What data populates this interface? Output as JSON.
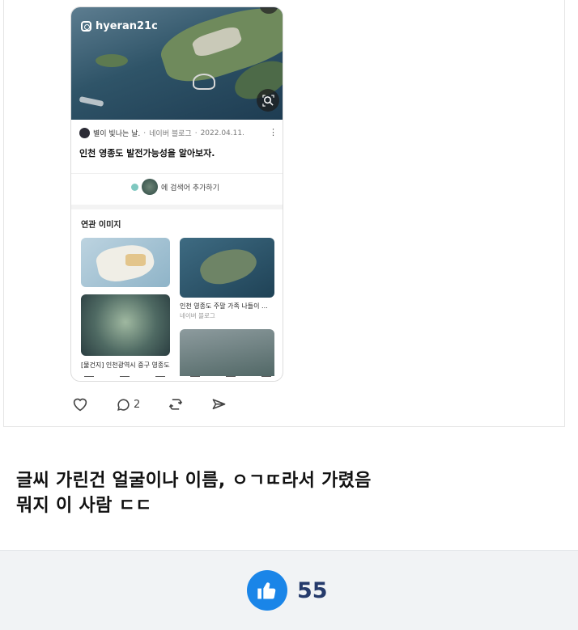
{
  "embed": {
    "instagram_handle": "hyeran21c",
    "author": "별이 빛나는 날.",
    "source": "네이버 블로그",
    "date": "2022.04.11.",
    "article_title": "인천 영종도 발전가능성을 알아보자.",
    "suggest_text": "에 검색어 추가하기",
    "related_title": "연관 이미지",
    "related": [
      {
        "caption": "[물건지] 인천광역시 중구 영종도"
      },
      {
        "caption": "인천 영종도 주말 가족 나들이 ...",
        "source": "네이버 블로그"
      }
    ]
  },
  "actions": {
    "comment_count": "2"
  },
  "comment": {
    "line1": "글씨 가린건 얼굴이나 이름, ㅇㄱㄸ라서 가렸음",
    "line2": "뭐지 이 사람 ㄷㄷ"
  },
  "like": {
    "count": "55",
    "color": "#1a85e8"
  }
}
